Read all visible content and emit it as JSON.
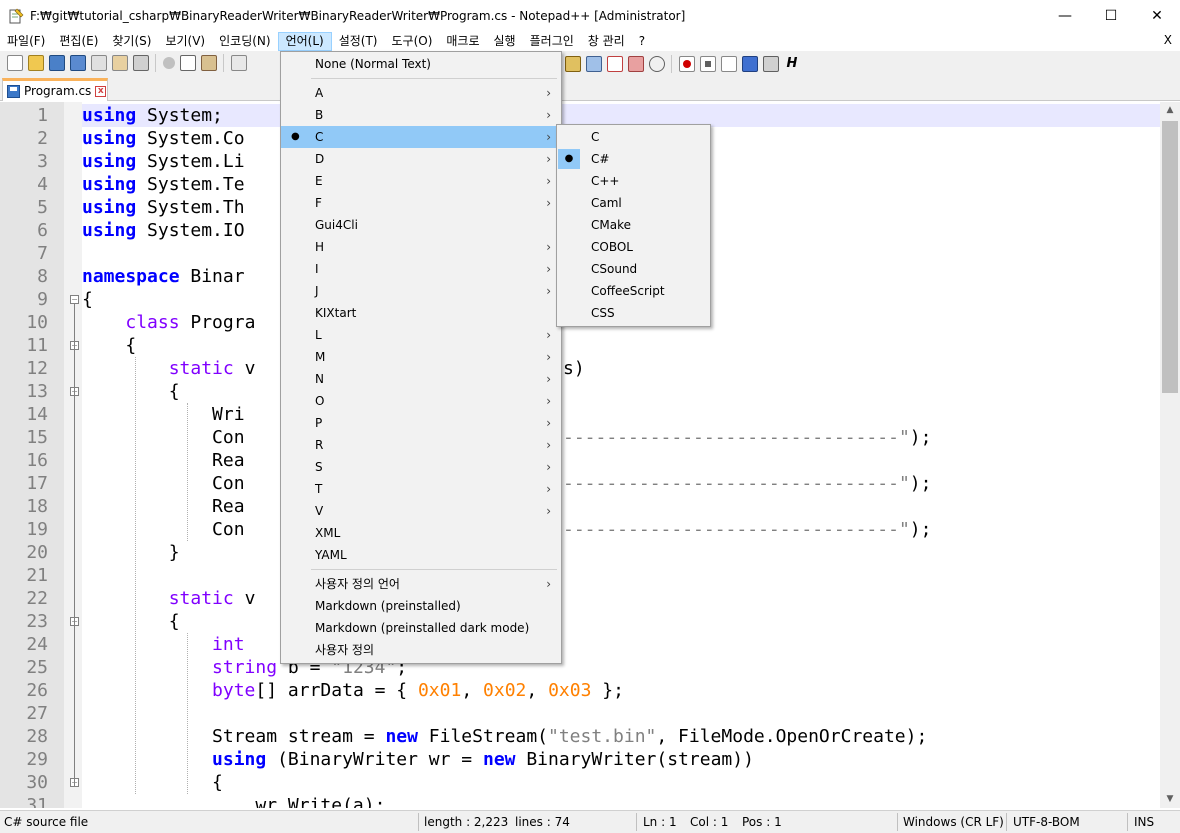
{
  "window": {
    "title": "F:₩git₩tutorial_csharp₩BinaryReaderWriter₩BinaryReaderWriter₩Program.cs - Notepad++ [Administrator]",
    "min_glyph": "—",
    "max_glyph": "☐",
    "close_glyph": "✕"
  },
  "menubar": {
    "items": [
      "파일(F)",
      "편집(E)",
      "찾기(S)",
      "보기(V)",
      "인코딩(N)",
      "언어(L)",
      "설정(T)",
      "도구(O)",
      "매크로",
      "실행",
      "플러그인",
      "창 관리",
      "?"
    ],
    "close": "X"
  },
  "tab": {
    "label": "Program.cs",
    "close": "x"
  },
  "editor": {
    "line_numbers": [
      "1",
      "2",
      "3",
      "4",
      "5",
      "6",
      "7",
      "8",
      "9",
      "10",
      "11",
      "12",
      "13",
      "14",
      "15",
      "16",
      "17",
      "18",
      "19",
      "20",
      "21",
      "22",
      "23",
      "24",
      "25",
      "26",
      "27",
      "28",
      "29",
      "30",
      "31"
    ],
    "lines": [
      {
        "n": 1,
        "kw": "using",
        "rest": " System;"
      },
      {
        "n": 2,
        "kw": "using",
        "rest": " System.Co"
      },
      {
        "n": 3,
        "kw": "using",
        "rest": " System.Li"
      },
      {
        "n": 4,
        "kw": "using",
        "rest": " System.Te"
      },
      {
        "n": 5,
        "kw": "using",
        "rest": " System.Th"
      },
      {
        "n": 6,
        "kw": "using",
        "rest": " System.IO"
      },
      {
        "n": 8,
        "kw": "namespace",
        "rest": " Binar"
      },
      {
        "n": 9,
        "rest": "{"
      },
      {
        "n": 10,
        "pad": "    ",
        "kw2": "class",
        "rest": " Progra"
      },
      {
        "n": 11,
        "pad": "    ",
        "rest": "{"
      },
      {
        "n": 12,
        "pad": "        ",
        "kw2": "static",
        "rest": " v"
      },
      {
        "n": 13,
        "pad": "        ",
        "rest": "{"
      },
      {
        "n": 14,
        "pad": "            ",
        "rest": "Wri"
      },
      {
        "n": 15,
        "pad": "            ",
        "rest": "Con"
      },
      {
        "n": 16,
        "pad": "            ",
        "rest": "Rea"
      },
      {
        "n": 17,
        "pad": "            ",
        "rest": "Con"
      },
      {
        "n": 18,
        "pad": "            ",
        "rest": "Rea"
      },
      {
        "n": 19,
        "pad": "            ",
        "rest": "Con"
      },
      {
        "n": 20,
        "pad": "        ",
        "rest": "}"
      },
      {
        "n": 22,
        "pad": "        ",
        "kw2": "static",
        "rest": " v"
      },
      {
        "n": 23,
        "pad": "        ",
        "rest": "{"
      },
      {
        "n": 24,
        "pad": "            ",
        "kw2": "int",
        "rest": ""
      },
      {
        "n": 25,
        "pad": "            ",
        "kw2": "string",
        "rest": " b = ",
        "str": "\"1234\"",
        "tail": ";"
      },
      {
        "n": 26,
        "pad": "            ",
        "kw2": "byte",
        "rest": "[] arrData = { ",
        "num1": "0x01",
        "c1": ", ",
        "num2": "0x02",
        "c2": ", ",
        "num3": "0x03",
        "tail": " };"
      },
      {
        "n": 28,
        "pad": "            ",
        "rest": "Stream stream = ",
        "kw": "new",
        "rest2": " FileStream(",
        "str": "\"test.bin\"",
        "tail": ", FileMode.OpenOrCreate);"
      },
      {
        "n": 29,
        "pad": "            ",
        "kwb": "using",
        "rest": " (BinaryWriter wr = ",
        "kw": "new",
        "tail": " BinaryWriter(stream))"
      },
      {
        "n": 30,
        "pad": "            ",
        "rest": "{"
      },
      {
        "n": 31,
        "pad": "                ",
        "rest": "wr.Write(a);"
      }
    ],
    "right_fragments": [
      {
        "n": 12,
        "text": "s)"
      },
      {
        "n": 15,
        "text": "-------------------------------\");"
      },
      {
        "n": 17,
        "text": "-------------------------------\");"
      },
      {
        "n": 19,
        "text": "-------------------------------\");"
      }
    ]
  },
  "language_menu": {
    "items": [
      {
        "label": "None (Normal Text)",
        "sub": false
      },
      {
        "label": "A",
        "sub": true
      },
      {
        "label": "B",
        "sub": true
      },
      {
        "label": "C",
        "sub": true,
        "checked": true,
        "highlighted": true
      },
      {
        "label": "D",
        "sub": true
      },
      {
        "label": "E",
        "sub": true
      },
      {
        "label": "F",
        "sub": true
      },
      {
        "label": "Gui4Cli",
        "sub": false
      },
      {
        "label": "H",
        "sub": true
      },
      {
        "label": "I",
        "sub": true
      },
      {
        "label": "J",
        "sub": true
      },
      {
        "label": "KIXtart",
        "sub": false
      },
      {
        "label": "L",
        "sub": true
      },
      {
        "label": "M",
        "sub": true
      },
      {
        "label": "N",
        "sub": true
      },
      {
        "label": "O",
        "sub": true
      },
      {
        "label": "P",
        "sub": true
      },
      {
        "label": "R",
        "sub": true
      },
      {
        "label": "S",
        "sub": true
      },
      {
        "label": "T",
        "sub": true
      },
      {
        "label": "V",
        "sub": true
      },
      {
        "label": "XML",
        "sub": false
      },
      {
        "label": "YAML",
        "sub": false
      },
      {
        "label": "사용자 정의 언어",
        "sub": true
      },
      {
        "label": "Markdown (preinstalled)",
        "sub": false
      },
      {
        "label": "Markdown (preinstalled dark mode)",
        "sub": false
      },
      {
        "label": "사용자 정의",
        "sub": false
      }
    ],
    "arrow": "›",
    "check": "●"
  },
  "c_submenu": {
    "items": [
      {
        "label": "C"
      },
      {
        "label": "C#",
        "checked": true
      },
      {
        "label": "C++"
      },
      {
        "label": "Caml"
      },
      {
        "label": "CMake"
      },
      {
        "label": "COBOL"
      },
      {
        "label": "CSound"
      },
      {
        "label": "CoffeeScript"
      },
      {
        "label": "CSS"
      }
    ]
  },
  "statusbar": {
    "filetype": "C# source file",
    "length": "length : 2,223",
    "lines": "lines : 74",
    "ln": "Ln : 1",
    "col": "Col : 1",
    "pos": "Pos : 1",
    "eol": "Windows (CR LF)",
    "encoding": "UTF-8-BOM",
    "mode": "INS"
  },
  "colors": {
    "keyword": "#0000ff",
    "type_keyword": "#8000ff",
    "string": "#808080",
    "number": "#ff8000",
    "menu_highlight": "#91c9f7",
    "tab_accent": "#fab25a"
  },
  "toolbar_icons": [
    "new-file-icon",
    "open-file-icon",
    "save-icon",
    "save-all-icon",
    "close-icon",
    "close-all-icon",
    "print-icon",
    "cut-icon",
    "copy-icon",
    "paste-icon",
    "undo-icon",
    "redo-icon",
    "macro-record-icon",
    "macro-stop-icon",
    "macro-play-icon",
    "macro-run-multiple-icon",
    "macro-save-icon",
    "spellcheck-icon"
  ]
}
